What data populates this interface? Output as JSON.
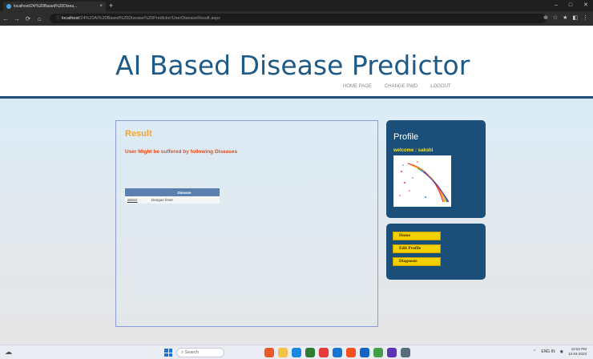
{
  "browser": {
    "tab_title": "localhost/24/%20Based%20Disea...",
    "tab_close": "×",
    "new_tab": "+",
    "window_buttons": [
      "–",
      "□",
      "✕"
    ],
    "nav_icons": [
      "←",
      "→",
      "⟳",
      "⌂"
    ],
    "url_host": "localhost",
    "url_path": "/24%20AI%20Based%20Disease%20Predictor/UserDiseaseResult.aspx",
    "toolbar_icons": [
      "⊕",
      "☆",
      "★",
      "◧",
      "⋮"
    ]
  },
  "site": {
    "title": "AI Based Disease Predictor",
    "nav": [
      "HOME PAGE",
      "CHANGE PWD",
      "LOGOUT"
    ]
  },
  "result": {
    "heading": "Result",
    "message": "User Might be suffered by following Diseases",
    "table": {
      "headers": [
        "",
        "Disease"
      ],
      "rows": [
        {
          "action": "Select",
          "disease": "Dengue fever"
        }
      ]
    }
  },
  "profile": {
    "heading": "Profile",
    "welcome": "welcome : sakshi"
  },
  "menu": {
    "buttons": [
      "Home",
      "Edit Profile",
      "Diagnosis"
    ]
  },
  "taskbar": {
    "search_placeholder": "Search",
    "time": "10:52 PM",
    "date": "12-04-2023",
    "lang": "ENG IN",
    "app_colors": [
      "#e55b2d",
      "#f3c246",
      "#1e88e5",
      "#2e7d32",
      "#e53935",
      "#1976d2",
      "#f4511e",
      "#1565c0",
      "#43a047",
      "#5e35b1",
      "#546e7a"
    ]
  }
}
